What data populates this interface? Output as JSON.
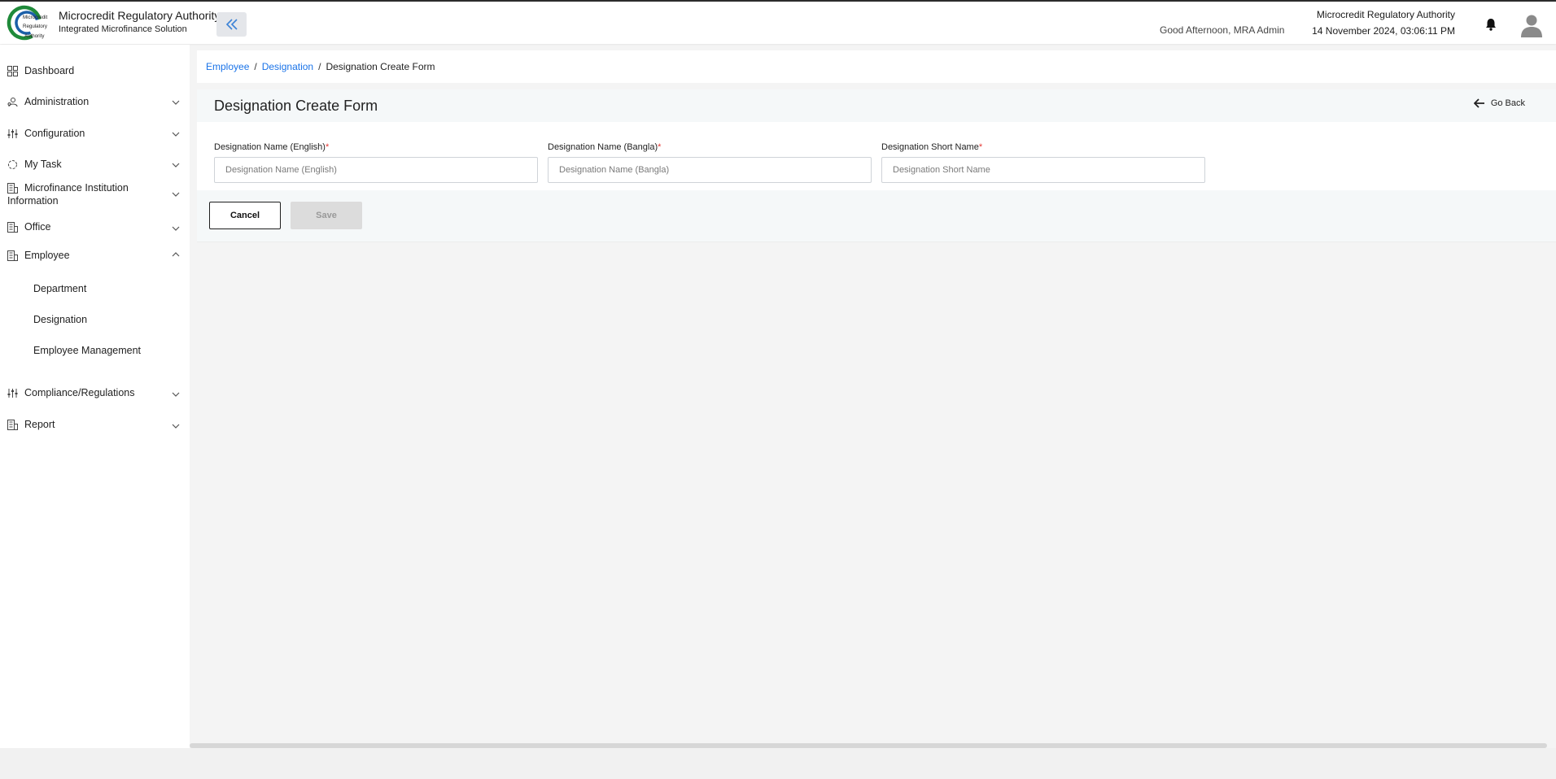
{
  "header": {
    "brand_title": "Microcredit Regulatory Authority",
    "brand_subtitle": "Integrated Microfinance Solution",
    "logo_text": [
      "Microcredit",
      "Regulatory",
      "Authority"
    ],
    "greeting": "Good Afternoon, MRA Admin",
    "org_name": "Microcredit Regulatory Authority",
    "datetime": "14 November 2024, 03:06:11 PM"
  },
  "sidebar": {
    "items": [
      {
        "label": "Dashboard",
        "icon": "grid-icon"
      },
      {
        "label": "Administration",
        "icon": "users-icon"
      },
      {
        "label": "Configuration",
        "icon": "sliders-icon"
      },
      {
        "label": "My Task",
        "icon": "spinner-icon"
      },
      {
        "label": "Microfinance Institution Information",
        "icon": "building-icon"
      },
      {
        "label": "Office",
        "icon": "building-icon"
      },
      {
        "label": "Employee",
        "icon": "building-icon"
      },
      {
        "label": "Compliance/Regulations",
        "icon": "sliders-icon"
      },
      {
        "label": "Report",
        "icon": "building-icon"
      }
    ],
    "employee_subitems": [
      "Department",
      "Designation",
      "Employee Management"
    ]
  },
  "breadcrumb": {
    "items": [
      "Employee",
      "Designation"
    ],
    "current": "Designation Create Form",
    "separator": "/"
  },
  "form": {
    "title": "Designation Create Form",
    "go_back": "Go Back",
    "fields": [
      {
        "label": "Designation Name (English)",
        "required_mark": "*",
        "placeholder": "Designation Name (English)",
        "value": ""
      },
      {
        "label": "Designation Name (Bangla)",
        "required_mark": "*",
        "placeholder": "Designation Name (Bangla)",
        "value": ""
      },
      {
        "label": "Designation Short Name",
        "required_mark": "*",
        "placeholder": "Designation Short Name",
        "value": ""
      }
    ],
    "cancel_label": "Cancel",
    "save_label": "Save"
  },
  "colors": {
    "link": "#1a73e8",
    "required": "#e53935",
    "logo_green": "#1f8a3a",
    "logo_blue": "#1b5fa8"
  }
}
